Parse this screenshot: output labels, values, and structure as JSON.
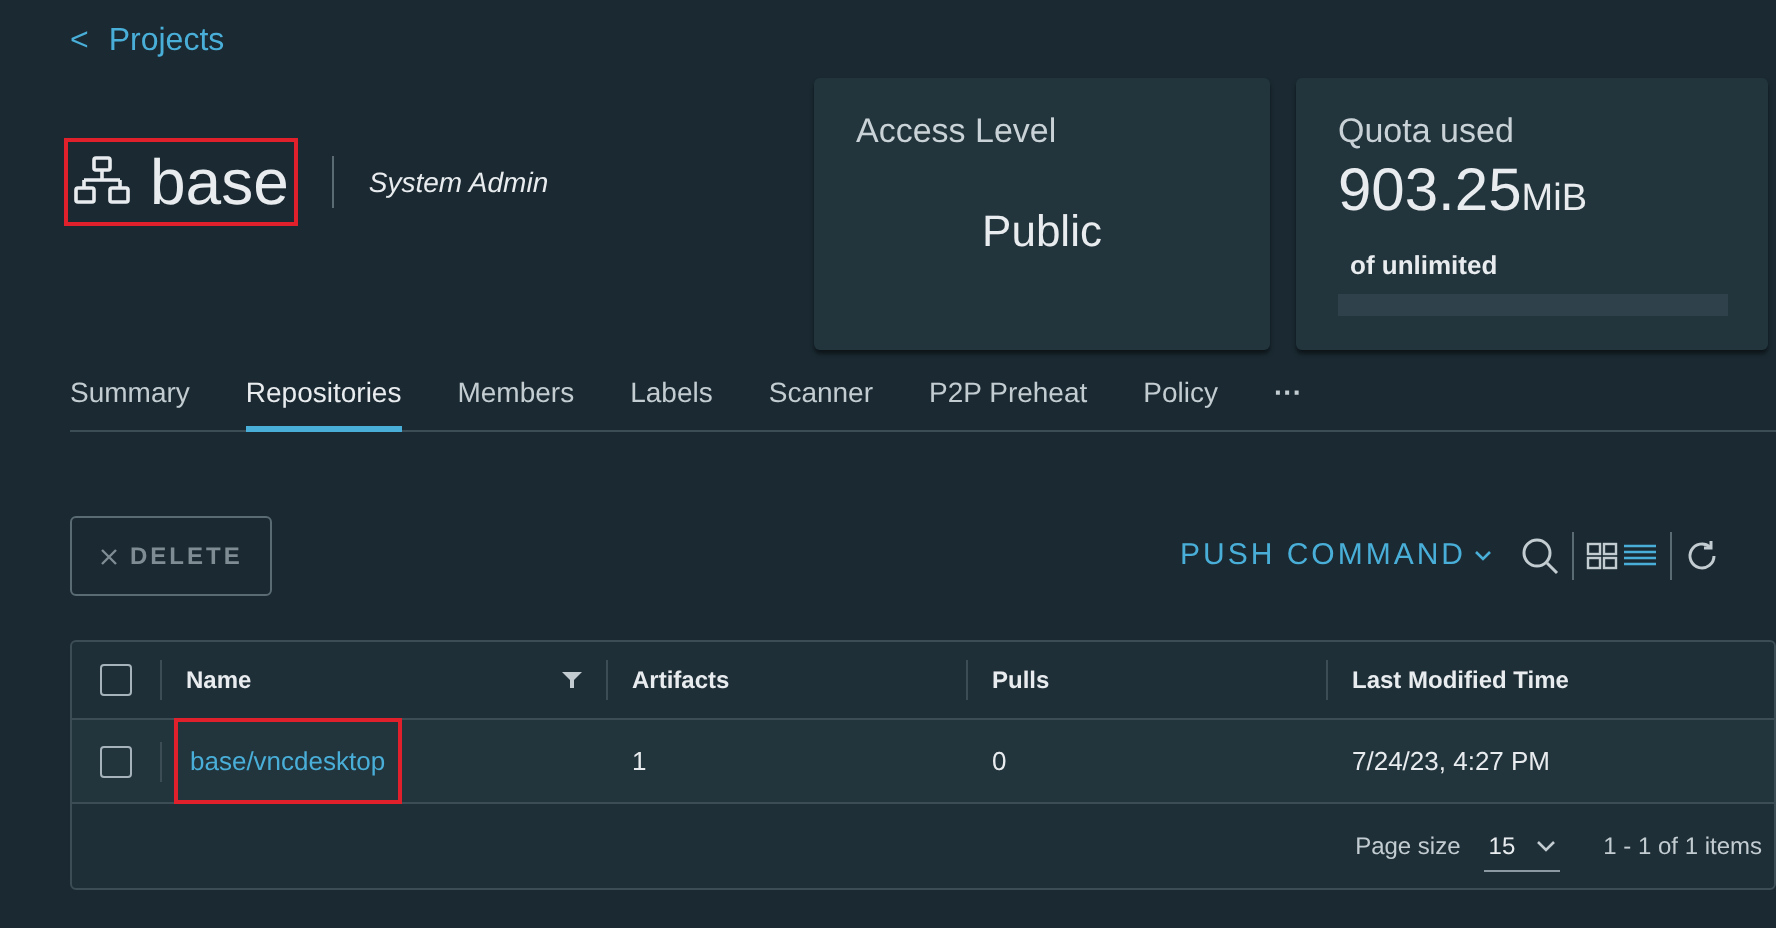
{
  "back_link": {
    "icon": "<",
    "label": "Projects"
  },
  "project": {
    "name": "base",
    "highlighted": true,
    "role": "System Admin"
  },
  "cards": [
    {
      "kind": "access",
      "title": "Access Level",
      "value": "Public"
    },
    {
      "kind": "quota",
      "title": "Quota used",
      "value": "903.25",
      "unit": "MiB",
      "subtitle": "of unlimited"
    }
  ],
  "tabs": [
    {
      "label": "Summary",
      "selected": false
    },
    {
      "label": "Repositories",
      "selected": true
    },
    {
      "label": "Members",
      "selected": false
    },
    {
      "label": "Labels",
      "selected": false
    },
    {
      "label": "Scanner",
      "selected": false
    },
    {
      "label": "P2P Preheat",
      "selected": false
    },
    {
      "label": "Policy",
      "selected": false
    },
    {
      "label": "···",
      "selected": false
    }
  ],
  "toolbar": {
    "delete": {
      "label": "DELETE",
      "disabled": true
    },
    "push_command": "PUSH COMMAND"
  },
  "table": {
    "all_checked": false,
    "columns": [
      {
        "label": "Name",
        "kind": "filterable"
      },
      {
        "label": "Artifacts",
        "kind": "plain"
      },
      {
        "label": "Pulls",
        "kind": "plain"
      },
      {
        "label": "Last Modified Time",
        "kind": "plain"
      }
    ],
    "rows": [
      {
        "checked": false,
        "highlighted": true,
        "cells": [
          "base/vncdesktop",
          "1",
          "0",
          "7/24/23, 4:27 PM"
        ]
      }
    ],
    "footer": {
      "page_size_label": "Page size",
      "page_size": "15",
      "range": "1 - 1 of 1 items"
    }
  }
}
